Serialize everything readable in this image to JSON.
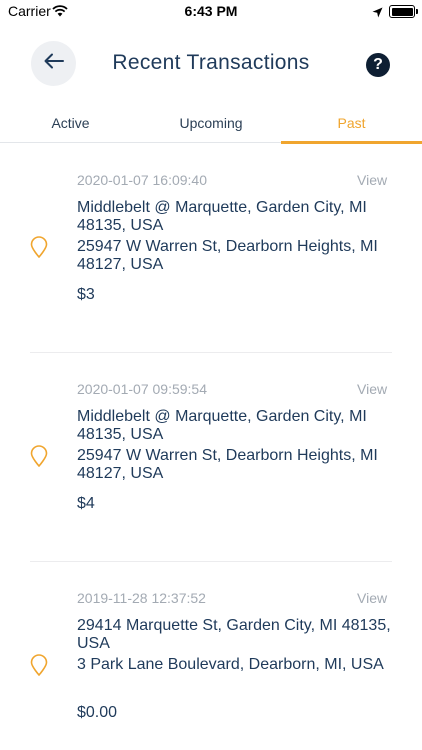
{
  "status": {
    "carrier": "Carrier",
    "time": "6:43 PM"
  },
  "header": {
    "title": "Recent Transactions",
    "help_label": "?"
  },
  "tabs": [
    {
      "label": "Active"
    },
    {
      "label": "Upcoming"
    },
    {
      "label": "Past",
      "selected": true
    }
  ],
  "colors": {
    "accent": "#f0a52e",
    "text": "#1f3a5a",
    "muted": "#a3aab3"
  },
  "transactions": [
    {
      "timestamp": "2020-01-07 16:09:40",
      "view_label": "View",
      "from": "Middlebelt @ Marquette, Garden City, MI 48135, USA",
      "to": "25947 W Warren St, Dearborn Heights, MI 48127, USA",
      "price": "$3"
    },
    {
      "timestamp": "2020-01-07 09:59:54",
      "view_label": "View",
      "from": "Middlebelt @ Marquette, Garden City, MI 48135, USA",
      "to": "25947 W Warren St, Dearborn Heights, MI 48127, USA",
      "price": "$4"
    },
    {
      "timestamp": "2019-11-28 12:37:52",
      "view_label": "View",
      "from": "29414 Marquette St, Garden City, MI 48135, USA",
      "to": "3 Park Lane Boulevard, Dearborn, MI, USA",
      "price": "$0.00"
    }
  ]
}
